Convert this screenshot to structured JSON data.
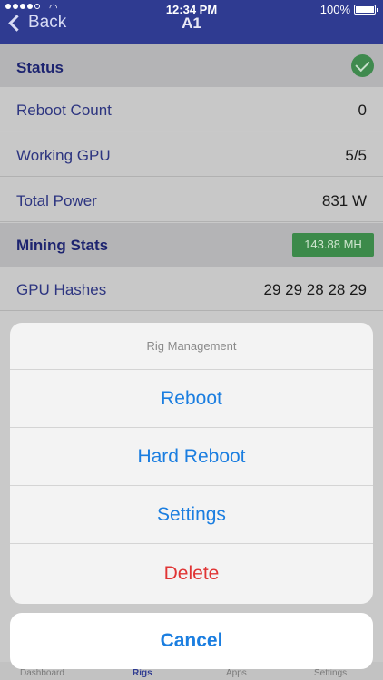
{
  "status_bar": {
    "time": "12:34 PM",
    "battery": "100%"
  },
  "nav": {
    "back_label": "Back",
    "title": "A1"
  },
  "status_section": {
    "title": "Status",
    "rows": [
      {
        "label": "Reboot Count",
        "value": "0"
      },
      {
        "label": "Working GPU",
        "value": "5/5"
      },
      {
        "label": "Total Power",
        "value": "831 W"
      }
    ]
  },
  "mining_section": {
    "title": "Mining Stats",
    "badge": "143.88 MH",
    "rows": [
      {
        "label": "GPU Hashes",
        "value": "29 29 28 28 29"
      }
    ]
  },
  "action_sheet": {
    "title": "Rig Management",
    "actions": [
      "Reboot",
      "Hard Reboot",
      "Settings",
      "Delete"
    ],
    "cancel": "Cancel"
  },
  "tabbar": {
    "tabs": [
      "Dashboard",
      "Rigs",
      "Apps",
      "Settings"
    ],
    "active": "Rigs"
  },
  "colors": {
    "nav_bg": "#2f3b91",
    "accent_blue": "#1b7ee0",
    "destructive_red": "#e03434",
    "status_green": "#3f8a4e"
  }
}
